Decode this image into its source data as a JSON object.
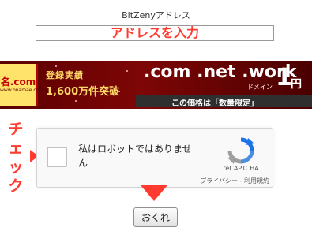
{
  "address": {
    "label": "BitZenyアドレス",
    "input_hint": "アドレスを入力",
    "value": ""
  },
  "banner": {
    "logo_text": "名.com",
    "logo_sub": "www.onamae.com",
    "registered_label": "登録実績",
    "registered_count": "1,600万件突破",
    "domains": ".com .net .work",
    "domains_sub": "ドメイン",
    "price": "1",
    "price_unit": "円",
    "strip_text": "この価格は「数量限定」"
  },
  "annotation": {
    "check_label": "チェック"
  },
  "recaptcha": {
    "label": "私はロボットではありません",
    "brand": "reCAPTCHA",
    "links": "プライバシー - 利用規約",
    "checked": false
  },
  "form": {
    "submit_label": "おくれ"
  },
  "colors": {
    "annotation_red": "#ff3b30",
    "banner_red": "#7e0606",
    "recaptcha_blue": "#1a73e8"
  }
}
